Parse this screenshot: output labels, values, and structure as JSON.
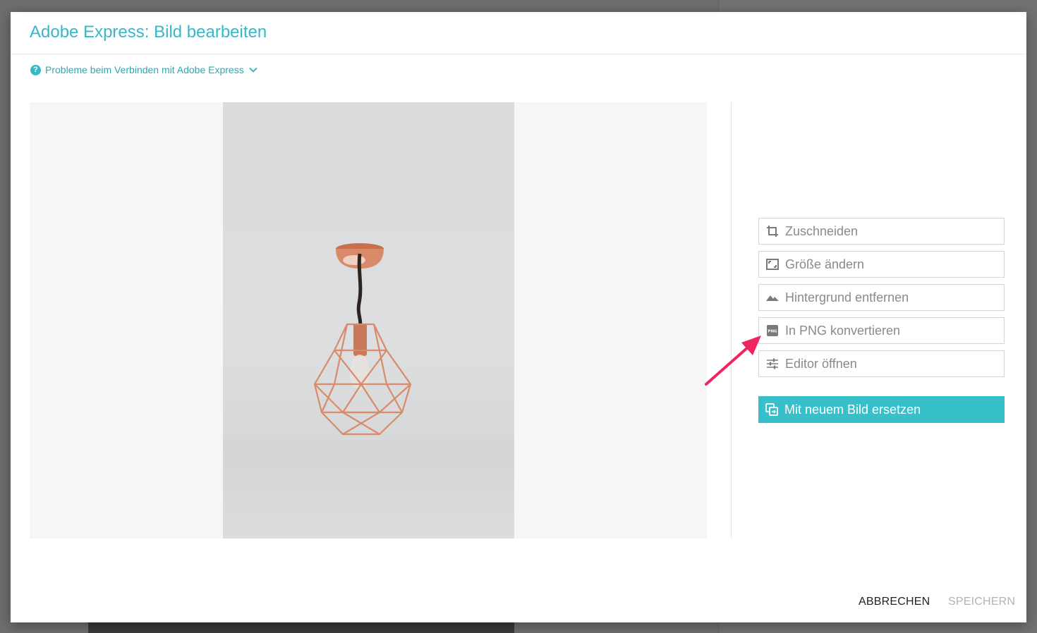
{
  "dialog": {
    "title": "Adobe Express: Bild bearbeiten",
    "help_link": "Probleme beim Verbinden mit Adobe Express"
  },
  "actions": [
    {
      "label": "Zuschneiden",
      "icon": "crop-icon"
    },
    {
      "label": "Größe ändern",
      "icon": "resize-icon"
    },
    {
      "label": "Hintergrund entfernen",
      "icon": "landscape-icon"
    },
    {
      "label": "In PNG konvertieren",
      "icon": "png-icon"
    },
    {
      "label": "Editor öffnen",
      "icon": "sliders-icon"
    }
  ],
  "replace_button": "Mit neuem Bild ersetzen",
  "footer": {
    "cancel": "ABBRECHEN",
    "save": "SPEICHERN"
  },
  "colors": {
    "accent": "#37b8c8",
    "primary_button": "#37bfca",
    "annotation_arrow": "#f0245f",
    "lamp_copper": "#d98a6a"
  }
}
